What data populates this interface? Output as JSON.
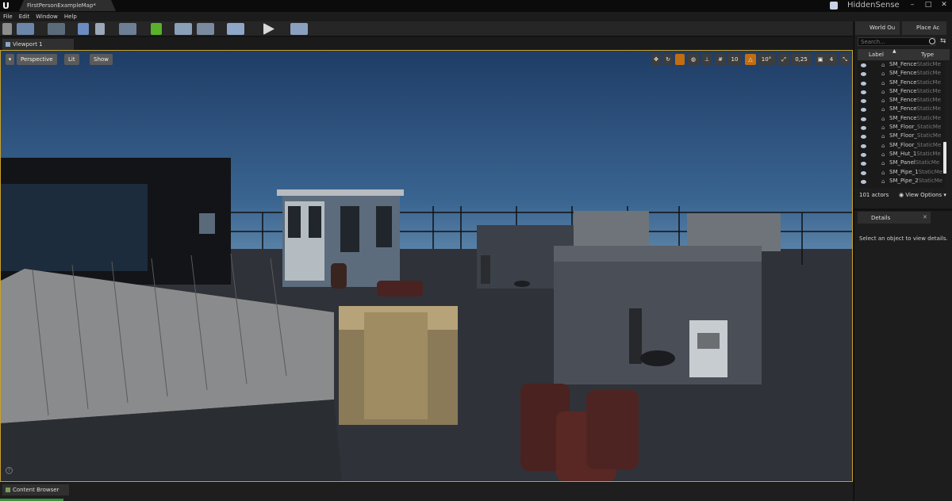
{
  "title_bar": {
    "logo": "U",
    "map_tab": "FirstPersonExampleMap*",
    "project": "HiddenSense"
  },
  "menu": [
    "File",
    "Edit",
    "Window",
    "Help"
  ],
  "viewport_tab": "Viewport 1",
  "viewport": {
    "buttons": {
      "perspective": "Perspective",
      "lit": "Lit",
      "show": "Show"
    },
    "grid_snap": "10",
    "rotation_snap": "10°",
    "scale_snap": "0,25",
    "camera_speed": "4"
  },
  "content_browser_tab": "Content Browser",
  "world_outliner": {
    "tab_world": "World Ou",
    "tab_place": "Place Ac",
    "search_placeholder": "Search...",
    "col_label": "Label",
    "col_type": "Type",
    "rows": [
      {
        "label": "SM_Fence",
        "type": "StaticMe"
      },
      {
        "label": "SM_Fence",
        "type": "StaticMe"
      },
      {
        "label": "SM_Fence",
        "type": "StaticMe"
      },
      {
        "label": "SM_Fence",
        "type": "StaticMe"
      },
      {
        "label": "SM_Fence",
        "type": "StaticMe"
      },
      {
        "label": "SM_Fence",
        "type": "StaticMe"
      },
      {
        "label": "SM_Fence",
        "type": "StaticMe"
      },
      {
        "label": "SM_Floor_",
        "type": "StaticMe"
      },
      {
        "label": "SM_Floor_",
        "type": "StaticMe"
      },
      {
        "label": "SM_Floor_",
        "type": "StaticMe"
      },
      {
        "label": "SM_Hut_1",
        "type": "StaticMe"
      },
      {
        "label": "SM_Panel",
        "type": "StaticMe"
      },
      {
        "label": "SM_Pipe_1",
        "type": "StaticMe"
      },
      {
        "label": "SM_Pipe_2",
        "type": "StaticMe"
      }
    ],
    "actor_count": "101 actors",
    "view_options": "View Options"
  },
  "details": {
    "tab": "Details",
    "message": "Select an object to view details."
  },
  "colors": {
    "accent": "#c9a02a",
    "panel": "#1d1d1d",
    "toolbar": "#262626"
  }
}
